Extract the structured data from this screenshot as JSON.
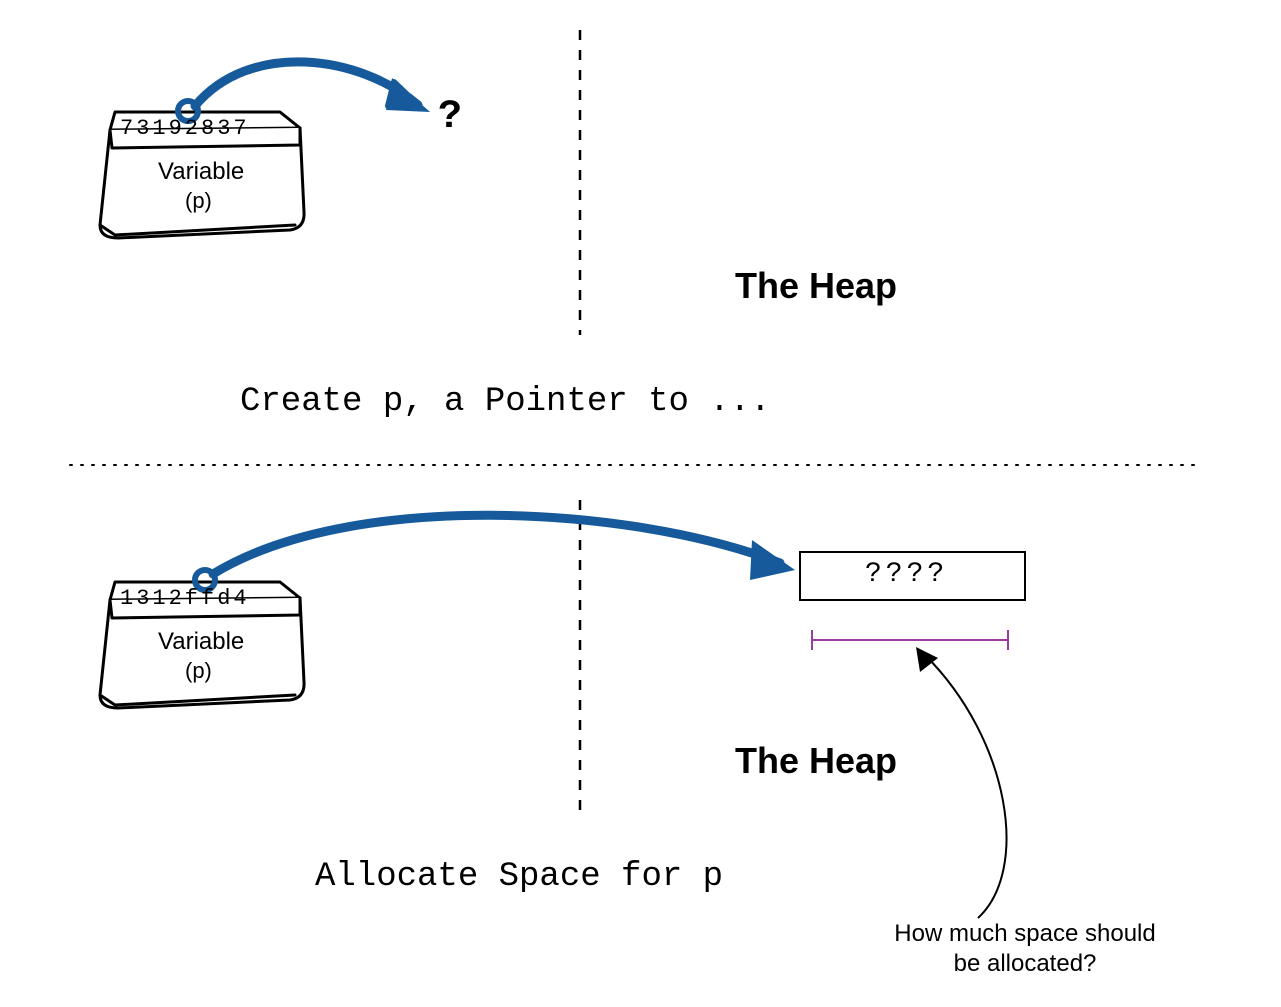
{
  "top": {
    "box_value": "73192837",
    "box_label_1": "Variable",
    "box_label_2": "(p)",
    "pointer_target": "?",
    "heap_label": "The Heap",
    "caption": "Create p, a Pointer to ..."
  },
  "bottom": {
    "box_value": "1312ffd4",
    "box_label_1": "Variable",
    "box_label_2": "(p)",
    "heap_cell": "????",
    "heap_label": "The Heap",
    "caption": "Allocate Space for p",
    "annotation_1": "How much space should",
    "annotation_2": "be allocated?"
  },
  "colors": {
    "arrow": "#175a9c",
    "bracket": "#9b3b9b"
  }
}
